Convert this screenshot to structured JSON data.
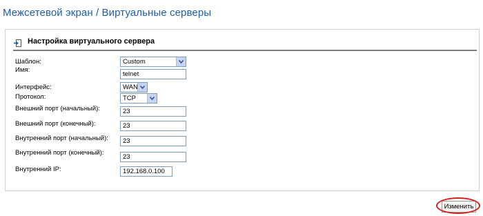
{
  "page": {
    "title": "Межсетевой экран / Виртуальные серверы"
  },
  "section": {
    "title": "Настройка виртуального сервера",
    "icon": "arrow-into-box-icon"
  },
  "form": {
    "template": {
      "label": "Шаблон:",
      "value": "Custom"
    },
    "name": {
      "label": "Имя:",
      "value": "telnet"
    },
    "interface": {
      "label": "Интерфейс:",
      "value": "WAN"
    },
    "protocol": {
      "label": "Протокол:",
      "value": "TCP"
    },
    "ext_port_start": {
      "label": "Внешний порт (начальный):",
      "value": "23"
    },
    "ext_port_end": {
      "label": "Внешний порт (конечный):",
      "value": "23"
    },
    "int_port_start": {
      "label": "Внутренний порт (начальный):",
      "value": "23"
    },
    "int_port_end": {
      "label": "Внутренний порт (конечный):",
      "value": "23"
    },
    "internal_ip": {
      "label": "Внутренний IP:",
      "value": "192.168.0.100"
    }
  },
  "actions": {
    "apply_label": "Изменить"
  },
  "colors": {
    "title": "#1f5fa6",
    "highlight": "#d02020",
    "field_border": "#7f9db9"
  }
}
